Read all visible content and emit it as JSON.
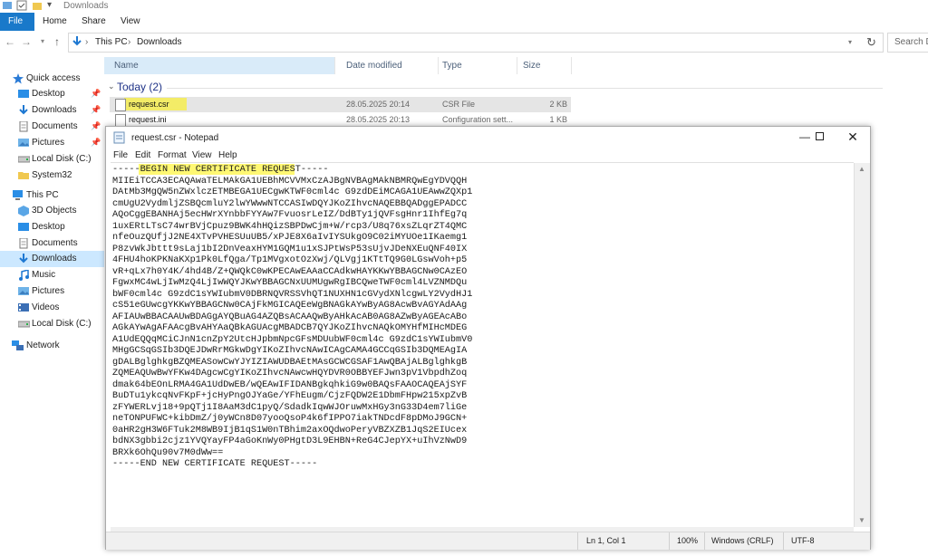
{
  "explorer": {
    "title": "Downloads",
    "ribbon_tabs": [
      "File",
      "Home",
      "Share",
      "View"
    ],
    "breadcrumb": [
      "This PC",
      "Downloads"
    ],
    "search_placeholder": "Search Do",
    "nav": [
      {
        "label": "Quick access",
        "icon": "star-icon"
      },
      {
        "label": "Desktop",
        "icon": "desktop-folder-icon",
        "pinned": true
      },
      {
        "label": "Downloads",
        "icon": "downloads-folder-icon",
        "pinned": true
      },
      {
        "label": "Documents",
        "icon": "documents-folder-icon",
        "pinned": true
      },
      {
        "label": "Pictures",
        "icon": "pictures-folder-icon",
        "pinned": true
      },
      {
        "label": "Local Disk (C:)",
        "icon": "drive-icon"
      },
      {
        "label": "System32",
        "icon": "folder-icon"
      },
      {
        "label": "This PC",
        "icon": "computer-icon"
      },
      {
        "label": "3D Objects",
        "icon": "3d-objects-icon"
      },
      {
        "label": "Desktop",
        "icon": "desktop-folder-icon"
      },
      {
        "label": "Documents",
        "icon": "documents-folder-icon"
      },
      {
        "label": "Downloads",
        "icon": "downloads-folder-icon",
        "selected": true
      },
      {
        "label": "Music",
        "icon": "music-icon"
      },
      {
        "label": "Pictures",
        "icon": "pictures-folder-icon"
      },
      {
        "label": "Videos",
        "icon": "videos-icon"
      },
      {
        "label": "Local Disk (C:)",
        "icon": "drive-icon"
      },
      {
        "label": "Network",
        "icon": "network-icon"
      }
    ],
    "columns": {
      "name": "Name",
      "date": "Date modified",
      "type": "Type",
      "size": "Size"
    },
    "group_label": "Today (2)",
    "files": [
      {
        "name": "request.csr",
        "date": "28.05.2025 20:14",
        "type": "CSR File",
        "size": "2 KB",
        "selected": true
      },
      {
        "name": "request.ini",
        "date": "28.05.2025 20:13",
        "type": "Configuration sett...",
        "size": "1 KB"
      }
    ]
  },
  "notepad": {
    "title": "request.csr - Notepad",
    "menu": [
      "File",
      "Edit",
      "Format",
      "View",
      "Help"
    ],
    "lines": [
      "-----BEGIN NEW CERTIFICATE REQUEST-----",
      "MIIEiTCCA3ECAQAwaTELMAkGA1UEBhMCVVMxCzAJBgNVBAgMAkNBMRQwEgYDVQQH",
      "DAtMb3MgQW5nZWxlczETMBEGA1UECgwKTWF0cml4c G9zdDEiMCAGA1UEAwwZQXp1",
      "cmUgU2VydmljZSBQcmluY2lwYWwwNTCCASIwDQYJKoZIhvcNAQEBBQADggEPADCC",
      "AQoCggEBANHAj5ecHWrXYnbbFYYAw7FvuosrLeIZ/DdBTy1jQVFsgHnr1IhfEg7q",
      "1uxERtLTsC74wrBVjCpuz9BWK4hHQizSBPDwCjm+W/rcp3/U8q76xsZLqrZT4QMC",
      "nfeOuzQUfjJ2NE4XTvPVHESUuUB5/xPJE8X6aIvIYSUkgO9C02iMYUOe1IKaemg1",
      "P8zvWkJbttt9sLaj1bI2DnVeaxHYM1GQM1u1xSJPtWsP53sUjvJDeNXEuQNF40IX",
      "4FHU4hoKPKNaKXp1Pk0LfQga/Tp1MVgxotOzXwj/QLVgj1KTtTQ9G0LGswVoh+p5",
      "vR+qLx7h0Y4K/4hd4B/Z+QWQkC0wKPECAwEAAaCCAdkwHAYKKwYBBAGCNw0CAzEO",
      "FgwxMC4wLjIwMzQ4LjIwWQYJKwYBBAGCNxUUMUgwRgIBCQweTWF0cml4LVZNMDQu",
      "bWF0cml4c G9zdC1sYWIubmV0DBRNQVRSSVhQT1NUXHN1cGVydXNlcgwLY2VydHJ1",
      "cS51eGUwcgYKKwYBBAGCNw0CAjFkMGICAQEeWgBNAGkAYwByAG8AcwBvAGYAdAAg",
      "AFIAUwBBACAAUwBDAGgAYQBuAG4AZQBsACAAQwByAHkAcAB0AG8AZwByAGEAcABo",
      "AGkAYwAgAFAAcgBvAHYAaQBkAGUAcgMBADCB7QYJKoZIhvcNAQkOMYHfMIHcMDEG",
      "A1UdEQQqMCiCJnN1cnZpY2UtcHJpbmNpcGFsMDUubWF0cml4c G9zdC1sYWIubmV0",
      "MHgGCSqGSIb3DQEJDwRrMGkwDgYIKoZIhvcNAwICAgCAMA4GCCqGSIb3DQMEAgIA",
      "gDALBglghkgBZQMEASowCwYJYIZIAWUDBAEtMAsGCWCGSAF1AwQBAjALBglghkgB",
      "ZQMEAQUwBwYFKw4DAgcwCgYIKoZIhvcNAwcwHQYDVR0OBBYEFJwn3pV1VbpdhZoq",
      "dmak64bEOnLRMA4GA1UdDwEB/wQEAwIFIDANBgkqhkiG9w0BAQsFAAOCAQEAjSYF",
      "BuDTu1ykcqNvFKpF+jcHyPngOJYaGe/YFhEugm/CjzFQDW2E1DbmFHpw215xpZvB",
      "zFYWERLvj18+9pQTj1I8AaM3dC1pyQ/SdadkIqwWJOruwMxHGy3nG33D4em7liGe",
      "neTONPUFWC+kibDmZ/j0yWCn8D07yooQsoP4k6fIPPO7iakTNDcdF8pDMoJ9GCN+",
      "0aHR2gH3W6FTuk2M8WB9IjB1qS1W0nTBhim2axOQdwoPeryVBZXZB1JqS2EIUcex",
      "bdNX3gbbi2cjz1YVQYayFP4aGoKnWy0PHgtD3L9EHBN+ReG4CJepYX+uIhVzNwD9",
      "BRXk6OhQu90v7M0dWw==",
      "-----END NEW CERTIFICATE REQUEST-----"
    ],
    "status": {
      "position": "Ln 1, Col 1",
      "zoom": "100%",
      "line_ending": "Windows (CRLF)",
      "encoding": "UTF-8"
    }
  },
  "colors": {
    "accent": "#1979ca",
    "selection": "#cce8ff",
    "highlight": "#fff200"
  }
}
